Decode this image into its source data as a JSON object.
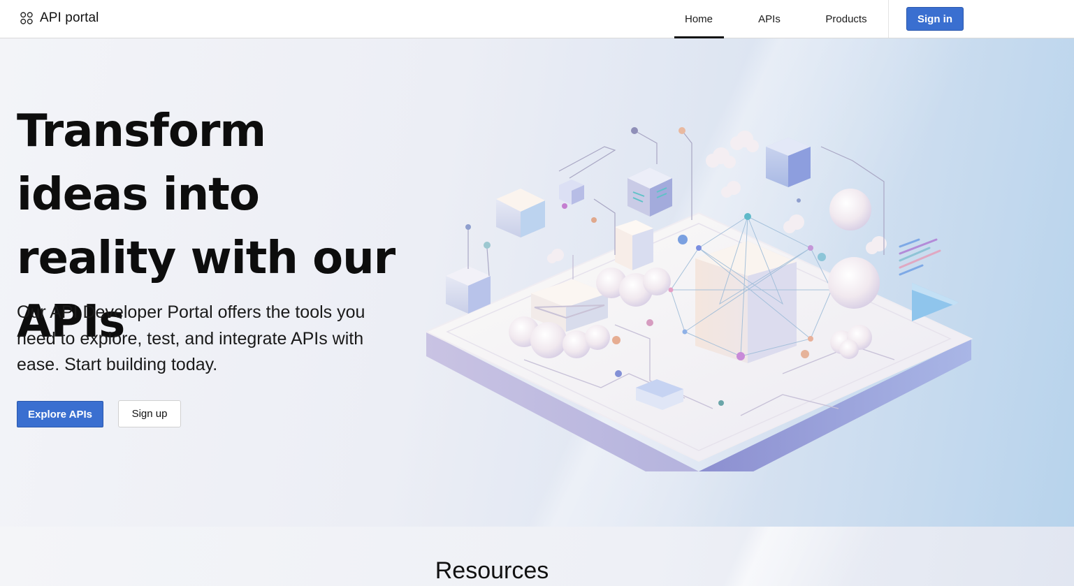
{
  "header": {
    "logo_text": "API portal",
    "nav": [
      {
        "label": "Home",
        "active": true
      },
      {
        "label": "APIs",
        "active": false
      },
      {
        "label": "Products",
        "active": false
      }
    ],
    "signin_label": "Sign in"
  },
  "hero": {
    "title": "Transform ideas into reality with our APIs",
    "subtitle": "Our API Developer Portal offers the tools you need to explore, test, and integrate APIs with ease. Start building today.",
    "primary_button": "Explore APIs",
    "secondary_button": "Sign up"
  },
  "resources": {
    "title": "Resources"
  },
  "colors": {
    "accent": "#3a6fd0",
    "hero_gradient_end": "#b7d3ec"
  },
  "icons": {
    "logo": "api-portal-logo-icon",
    "illustration": "isometric-api-platform-illustration"
  }
}
